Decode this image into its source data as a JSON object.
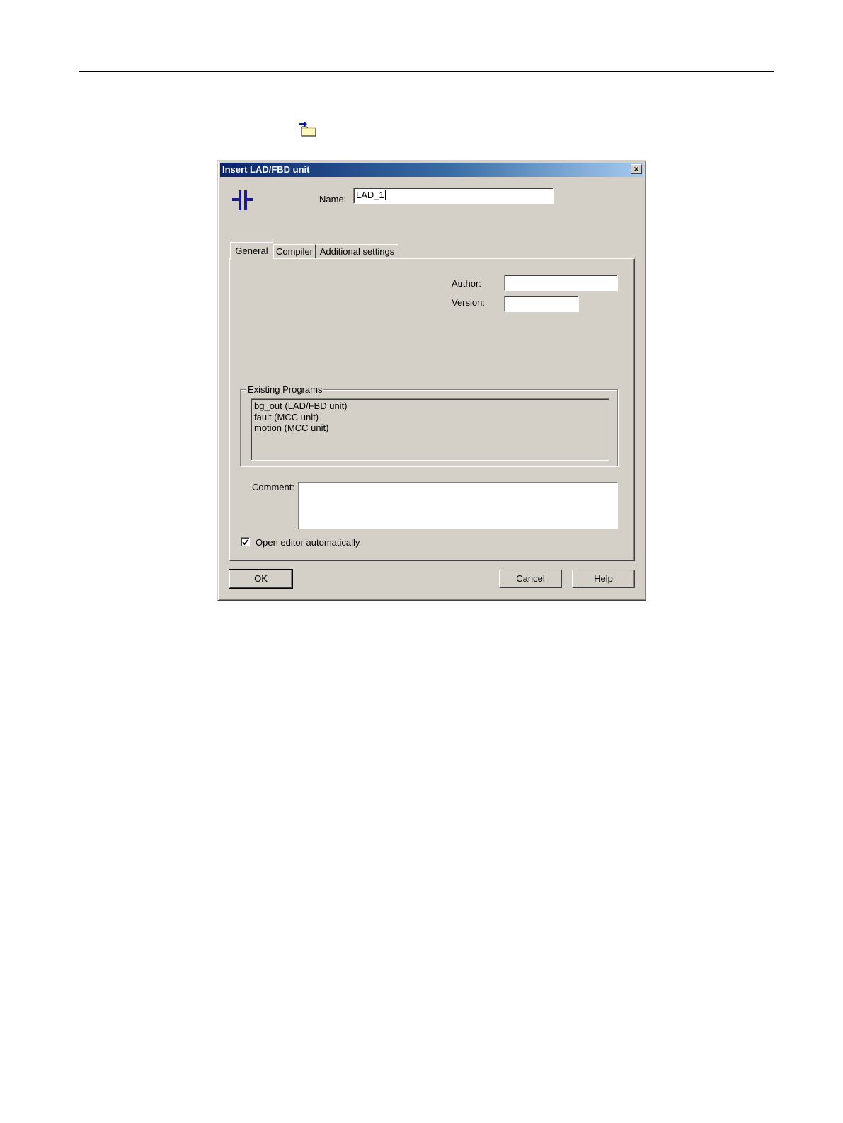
{
  "dialog": {
    "title": "Insert LAD/FBD unit",
    "close_glyph": "×",
    "name_label": "Name:",
    "name_value": "LAD_1",
    "tabs": [
      {
        "label": "General",
        "active": true
      },
      {
        "label": "Compiler",
        "active": false
      },
      {
        "label": "Additional settings",
        "active": false
      }
    ],
    "author_label": "Author:",
    "author_value": "",
    "version_label": "Version:",
    "version_value": "",
    "existing_programs_label": "Existing Programs",
    "existing_programs": [
      "bg_out (LAD/FBD unit)",
      "fault (MCC unit)",
      "motion (MCC unit)"
    ],
    "comment_label": "Comment:",
    "comment_value": "",
    "open_editor_label": "Open editor automatically",
    "open_editor_checked": true,
    "buttons": {
      "ok": "OK",
      "cancel": "Cancel",
      "help": "Help"
    }
  },
  "icons": {
    "toolbar_icon": "insert-unit-icon",
    "dialog_icon": "ladder-contact-icon"
  },
  "colors": {
    "dialog_bg": "#d4d0c8",
    "titlebar_start": "#0a246a",
    "titlebar_end": "#a6caf0",
    "icon_blue": "#1a1a8c"
  }
}
